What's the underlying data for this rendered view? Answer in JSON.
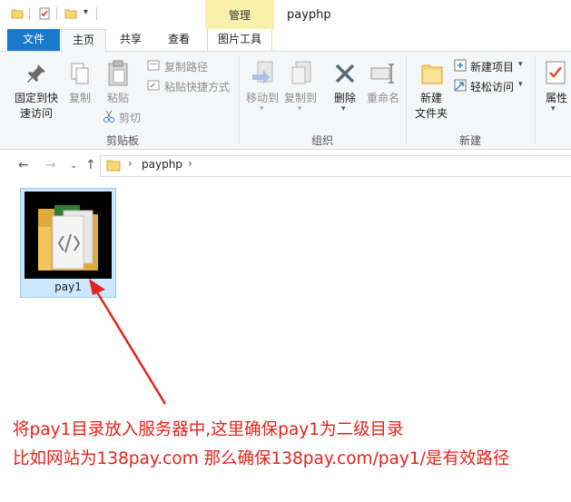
{
  "window": {
    "title": "payphp"
  },
  "tabs": {
    "file": "文件",
    "home": "主页",
    "share": "共享",
    "view": "查看",
    "context_group": "管理",
    "picture_tools": "图片工具"
  },
  "ribbon": {
    "pin": "固定到快\n速访问",
    "copy": "复制",
    "paste": "粘贴",
    "copy_path": "复制路径",
    "paste_shortcut": "粘贴快捷方式",
    "cut": "剪切",
    "clipboard_group": "剪贴板",
    "move_to": "移动到",
    "copy_to": "复制到",
    "delete": "删除",
    "rename": "重命名",
    "organize_group": "组织",
    "new_folder": "新建\n文件夹",
    "new_item": "新建项目",
    "easy_access": "轻松访问",
    "new_group": "新建",
    "properties": "属性"
  },
  "address": {
    "path": "payphp",
    "separator": "›"
  },
  "item": {
    "name": "pay1"
  },
  "annotation": {
    "line1": "将pay1目录放入服务器中,这里确保pay1为二级目录",
    "line2": "比如网站为138pay.com 那么确保138pay.com/pay1/是有效路径"
  },
  "colors": {
    "accent": "#1979ca",
    "context_tab": "#f7f1ad",
    "annotation": "#e3241b",
    "selection": "#cce8ff"
  }
}
